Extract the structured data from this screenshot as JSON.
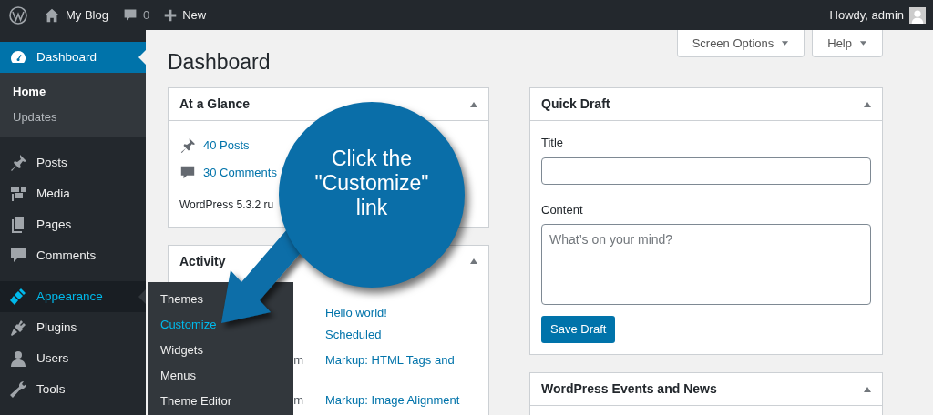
{
  "admin_bar": {
    "site_name": "My Blog",
    "comment_count": "0",
    "new_label": "New",
    "greeting": "Howdy, admin"
  },
  "sidebar": {
    "items": [
      {
        "label": "Dashboard",
        "selected": true,
        "hovered": false,
        "children": [
          {
            "label": "Home",
            "selected": true
          },
          {
            "label": "Updates",
            "selected": false
          }
        ]
      },
      {
        "label": "Posts",
        "selected": false,
        "hovered": false
      },
      {
        "label": "Media",
        "selected": false,
        "hovered": false
      },
      {
        "label": "Pages",
        "selected": false,
        "hovered": false
      },
      {
        "label": "Comments",
        "selected": false,
        "hovered": false
      },
      {
        "label": "Appearance",
        "selected": false,
        "hovered": true,
        "flyout": [
          {
            "label": "Themes",
            "selected": false
          },
          {
            "label": "Customize",
            "selected": true
          },
          {
            "label": "Widgets",
            "selected": false
          },
          {
            "label": "Menus",
            "selected": false
          },
          {
            "label": "Theme Editor",
            "selected": false
          }
        ]
      },
      {
        "label": "Plugins",
        "selected": false,
        "hovered": false
      },
      {
        "label": "Users",
        "selected": false,
        "hovered": false
      },
      {
        "label": "Tools",
        "selected": false,
        "hovered": false
      }
    ]
  },
  "screen_meta": [
    "Screen Options",
    "Help"
  ],
  "page_title": "Dashboard",
  "at_a_glance": {
    "title": "At a Glance",
    "posts": "40 Posts",
    "comments": "30 Comments",
    "version": "WordPress 5.3.2 ru"
  },
  "activity": {
    "title": "Activity",
    "rows": [
      {
        "title": "Hello world!"
      },
      {
        "title": "Scheduled"
      },
      {
        "date": "m",
        "title": "Markup: HTML Tags and"
      },
      {
        "date": "m",
        "title": "Markup: Image Alignment"
      }
    ]
  },
  "quick_draft": {
    "title": "Quick Draft",
    "title_label": "Title",
    "content_label": "Content",
    "content_placeholder": "What’s on your mind?",
    "button": "Save Draft"
  },
  "events": {
    "title": "WordPress Events and News"
  },
  "callout": {
    "text": "Click the\n\"Customize\"\nlink"
  }
}
